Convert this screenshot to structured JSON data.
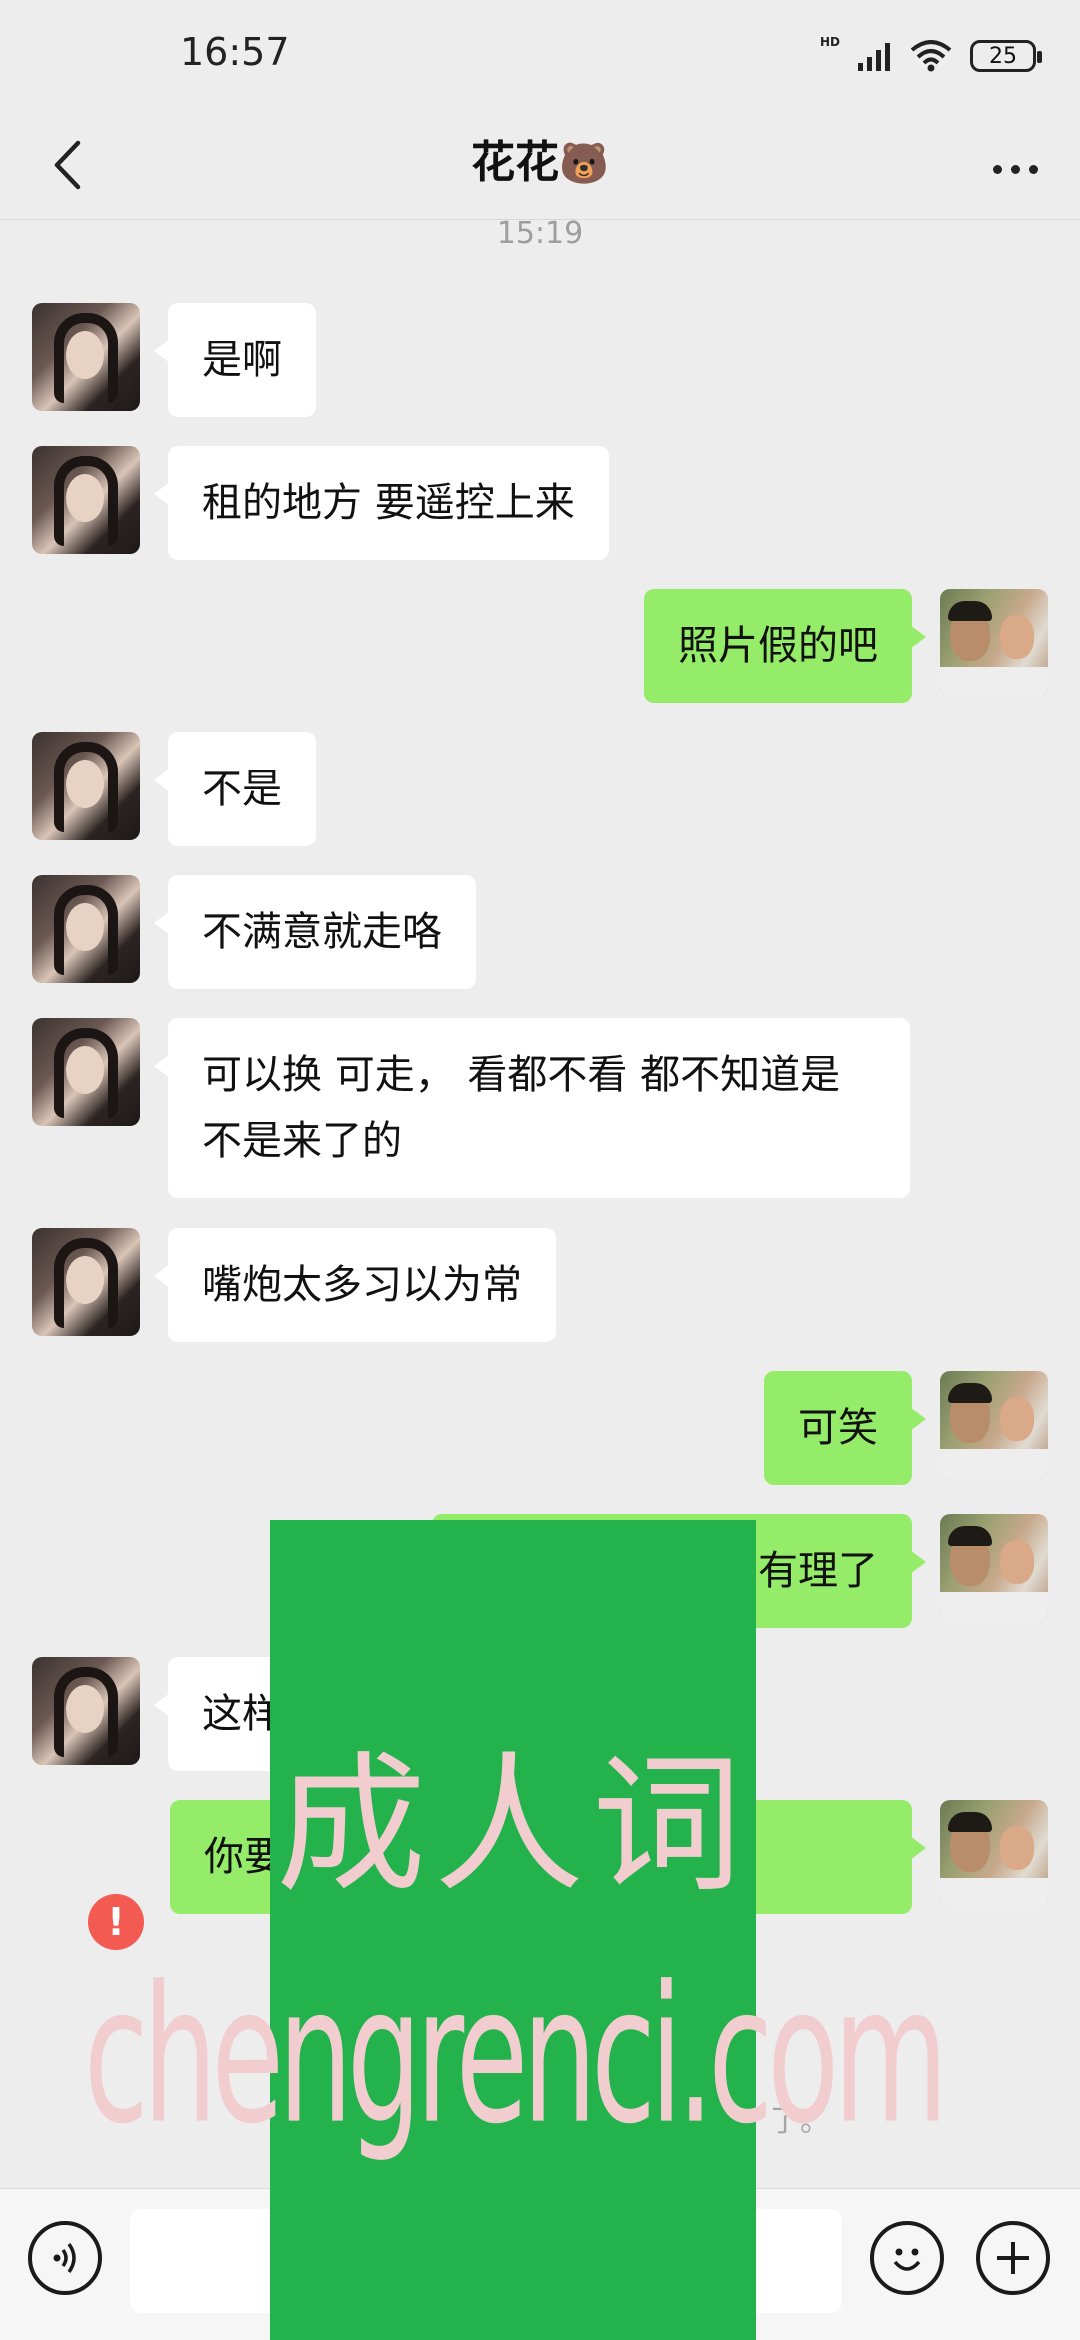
{
  "status": {
    "time": "16:57",
    "hd": "HD",
    "battery": "25"
  },
  "nav": {
    "title": "花花",
    "title_emoji": "🐻"
  },
  "timestamp": "15:19",
  "messages": [
    {
      "from": "her",
      "text": "是啊"
    },
    {
      "from": "her",
      "text": "租的地方 要遥控上来"
    },
    {
      "from": "me",
      "text": "照片假的吧"
    },
    {
      "from": "her",
      "text": "不是"
    },
    {
      "from": "her",
      "text": "不满意就走咯"
    },
    {
      "from": "her",
      "text": "可以换 可走，  看都不看 都不知道是不是来了的"
    },
    {
      "from": "her",
      "text": "嘴炮太多习以为常"
    },
    {
      "from": "me",
      "text": "可笑"
    },
    {
      "from": "me",
      "text": "有理了"
    },
    {
      "from": "her",
      "text": "这样"
    },
    {
      "from": "me",
      "text": "你要 几个人， 我就去挑",
      "failed": true
    }
  ],
  "recall_notice": "了。",
  "watermark": {
    "line1": "成人词",
    "line2": "chengrenci.com"
  },
  "colors": {
    "bg": "#ededed",
    "out_bubble": "#95ec69",
    "in_bubble": "#ffffff",
    "error": "#f25a52",
    "watermark_bg": "#23b24b"
  }
}
